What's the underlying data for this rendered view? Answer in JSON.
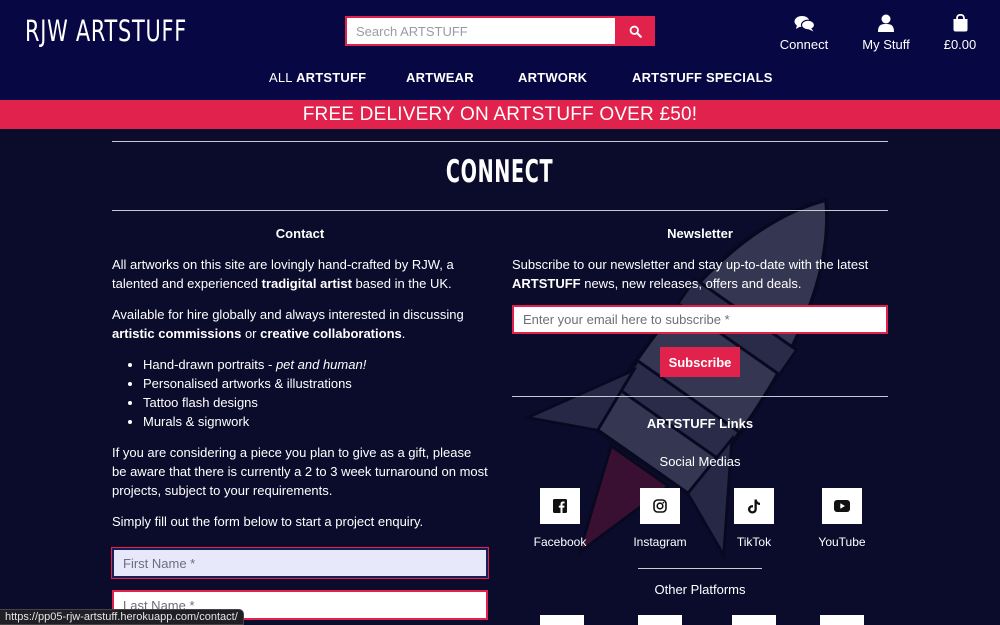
{
  "header": {
    "logo": "RJW ARTSTUFF",
    "search_placeholder": "Search ARTSTUFF",
    "links": {
      "connect": "Connect",
      "my_stuff": "My Stuff",
      "bag_total": "£0.00"
    },
    "icons": {
      "search": "search-icon",
      "connect": "comments-icon",
      "my_stuff": "user-icon",
      "bag": "shopping-bag-icon"
    }
  },
  "nav": [
    {
      "prefix": "ALL ",
      "label": "ARTSTUFF"
    },
    {
      "prefix": "",
      "label": "ARTWEAR"
    },
    {
      "prefix": "",
      "label": "ARTWORK"
    },
    {
      "prefix": "",
      "label": "ARTSTUFF SPECIALS"
    }
  ],
  "banner": "FREE DELIVERY ON ARTSTUFF OVER £50!",
  "page_title": "CONNECT",
  "contact": {
    "heading": "Contact",
    "p1_a": "All artworks on this site are lovingly hand-crafted by RJW, a talented and experienced ",
    "p1_b": "tradigital artist",
    "p1_c": " based in the UK.",
    "p2_a": "Available for hire globally and always interested in discussing ",
    "p2_b": "artistic commissions",
    "p2_c": " or ",
    "p2_d": "creative collaborations",
    "p2_e": ".",
    "list": [
      {
        "text": "Hand-drawn portraits - ",
        "em": "pet and human!"
      },
      {
        "text": "Personalised artworks & illustrations",
        "em": ""
      },
      {
        "text": "Tattoo flash designs",
        "em": ""
      },
      {
        "text": "Murals & signwork",
        "em": ""
      }
    ],
    "p3": "If you are considering a piece you plan to give as a gift, please be aware that there is currently a 2 to 3 week turnaround on most projects, subject to your requirements.",
    "p4": "Simply fill out the form below to start a project enquiry.",
    "first_name_placeholder": "First Name *",
    "last_name_placeholder": "Last Name *"
  },
  "newsletter": {
    "heading": "Newsletter",
    "p_a": "Subscribe to our newsletter and stay up-to-date with the latest ",
    "p_b": "ARTSTUFF",
    "p_c": " news, new releases, offers and deals.",
    "email_placeholder": "Enter your email here to subscribe *",
    "button": "Subscribe"
  },
  "links": {
    "heading": "ARTSTUFF Links",
    "social_heading": "Social Medias",
    "social": [
      {
        "label": "Facebook",
        "icon": "facebook-icon"
      },
      {
        "label": "Instagram",
        "icon": "instagram-icon"
      },
      {
        "label": "TikTok",
        "icon": "tiktok-icon"
      },
      {
        "label": "YouTube",
        "icon": "youtube-icon"
      }
    ],
    "other_heading": "Other Platforms"
  },
  "status_url": "https://pp05-rjw-artstuff.herokuapp.com/contact/",
  "colors": {
    "navy": "#070744",
    "accent": "#e0224c",
    "background": "#0b0c2b"
  }
}
